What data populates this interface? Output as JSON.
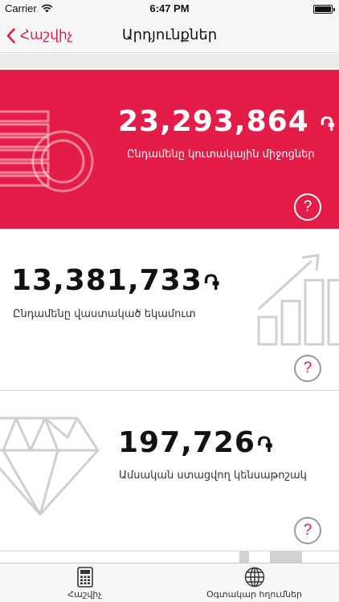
{
  "status_bar": {
    "carrier": "Carrier",
    "time": "6:47 PM"
  },
  "nav": {
    "back_label": "Հաշվիչ",
    "title": "Արդյունքներ"
  },
  "results": [
    {
      "amount": "23,293,864",
      "currency": "֏",
      "label": "Ընդամենը կուտակային միջոցներ",
      "help": "?",
      "icon": "coins-icon"
    },
    {
      "amount": "13,381,733",
      "currency": "֏",
      "label": "Ընդամենը վաստակած եկամուտ",
      "help": "?",
      "icon": "growth-chart-icon"
    },
    {
      "amount": "197,726",
      "currency": "֏",
      "label": "Ամսական ստացվող կենսաթոշակ",
      "help": "?",
      "icon": "diamond-icon"
    }
  ],
  "tabs": [
    {
      "label": "Հաշվիչ",
      "icon": "calculator-icon"
    },
    {
      "label": "Օգտակար հղումներ",
      "icon": "globe-icon"
    }
  ],
  "colors": {
    "accent": "#e31c48",
    "card_total_background": "#e31c48",
    "icon_gray": "#cfcfcf"
  }
}
